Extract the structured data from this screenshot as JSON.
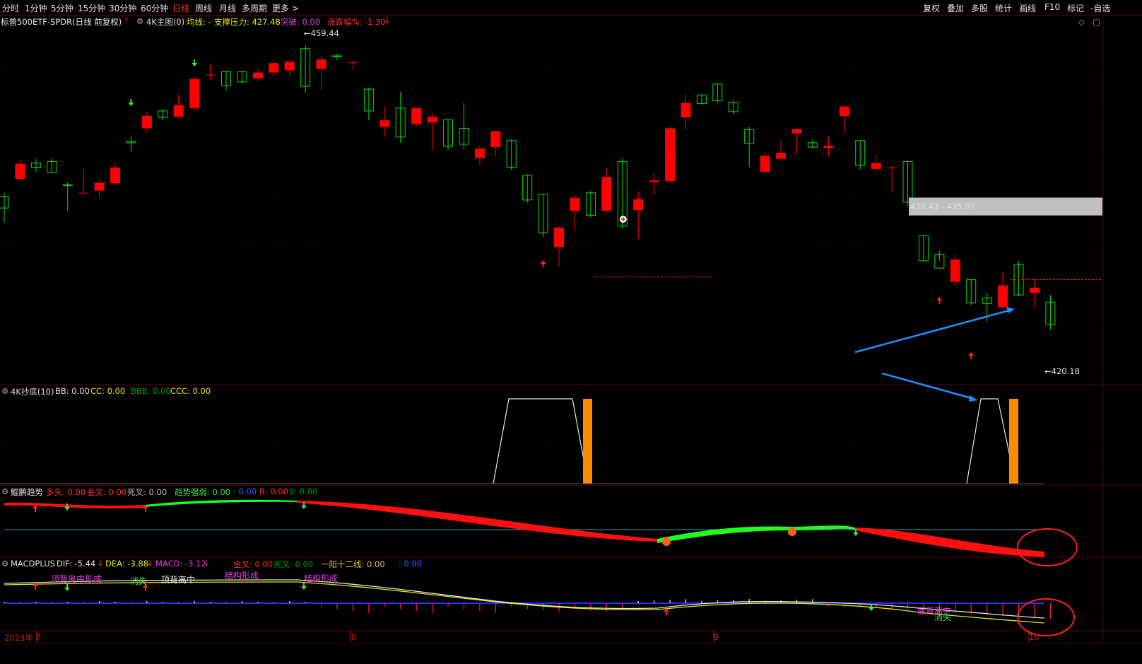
{
  "toolbar": {
    "left_tabs": [
      "分时",
      "1分钟",
      "5分钟",
      "15分钟",
      "30分钟",
      "60分钟",
      "日线",
      "周线",
      "月线",
      "多周期",
      "更多 >"
    ],
    "active": "日线",
    "right_buttons": [
      "复权",
      "叠加",
      "多股",
      "统计",
      "画线",
      "F10",
      "标记",
      "-自选"
    ]
  },
  "main_header": {
    "symbol": "标普500ETF-SPDR(日线 前复权)",
    "indicator": "4K主图(0)",
    "ma_label": "均线: -",
    "support_label": "支撑压力: 427.48",
    "break_label": "突破: 0.00",
    "change_label": "涨跌幅%: -1.30"
  },
  "price_annotations": {
    "high": "459.44",
    "low": "420.18",
    "zone": "438.43 - 435.97"
  },
  "panel_chaodi": {
    "title": "4K抄底(10)",
    "bb": "BB: 0.00",
    "cc": "CC: 0.00",
    "bbb": "BBB: 0.00",
    "ccc": "CCC: 0.00"
  },
  "panel_trend": {
    "title": "鲲鹏趋势",
    "duotou": "多头: 0.00",
    "jincha": "金叉: 0.00",
    "sicha": "死叉: 0.00",
    "strength": "趋势强弱: 0.00",
    "blank": ": 0.00",
    "b": "B: 0.00",
    "s": "S: 0.00"
  },
  "panel_macd": {
    "title": "MACDPLUS",
    "dif": "DIF: -5.44",
    "dea": "DEA: -3.88",
    "macd": "MACD: -3.12",
    "jincha": "金叉: 0.00",
    "sicha": "死叉: 0.00",
    "yiyang": "一阳十二线: 0.00",
    "blank": ": 0.00",
    "labels": [
      "顶背离中形成",
      "消失",
      "顶背离中",
      "结构形成",
      "结构形成",
      "底背离中",
      "消失"
    ]
  },
  "x_axis": {
    "year": "2023年",
    "months": [
      "7",
      "8",
      "9",
      "10"
    ]
  },
  "colors": {
    "up": "#ff0000",
    "down": "#00e000",
    "background": "#000000",
    "accent_red": "#ff3030",
    "zone_gray": "#c0c0c0",
    "blue_arrow": "#1e90ff",
    "orange_bar": "#ff8c00"
  },
  "chart_data": {
    "type": "candlestick",
    "title": "标普500ETF-SPDR",
    "candles": [
      {
        "o": 438.6,
        "h": 439.1,
        "l": 435.0,
        "c": 437.0
      },
      {
        "o": 441.0,
        "h": 443.6,
        "l": 441.0,
        "c": 443.1
      },
      {
        "o": 443.2,
        "h": 443.8,
        "l": 442.0,
        "c": 442.6
      },
      {
        "o": 443.4,
        "h": 443.9,
        "l": 441.8,
        "c": 441.9
      },
      {
        "o": 440.2,
        "h": 440.6,
        "l": 436.6,
        "c": 440.1
      },
      {
        "o": 439.1,
        "h": 442.4,
        "l": 439.0,
        "c": 439.1
      },
      {
        "o": 439.4,
        "h": 441.0,
        "l": 438.4,
        "c": 440.5
      },
      {
        "o": 440.4,
        "h": 443.3,
        "l": 440.2,
        "c": 442.6
      },
      {
        "o": 446.2,
        "h": 447.0,
        "l": 444.8,
        "c": 446.0
      },
      {
        "o": 448.0,
        "h": 450.2,
        "l": 447.4,
        "c": 449.7
      },
      {
        "o": 450.4,
        "h": 450.6,
        "l": 449.1,
        "c": 449.5
      },
      {
        "o": 449.6,
        "h": 452.7,
        "l": 449.5,
        "c": 451.2
      },
      {
        "o": 450.8,
        "h": 455.1,
        "l": 450.6,
        "c": 454.8
      },
      {
        "o": 455.3,
        "h": 457.0,
        "l": 454.6,
        "c": 455.4
      },
      {
        "o": 455.8,
        "h": 455.8,
        "l": 453.2,
        "c": 453.9
      },
      {
        "o": 455.8,
        "h": 455.9,
        "l": 454.2,
        "c": 454.4
      },
      {
        "o": 454.9,
        "h": 456.2,
        "l": 454.5,
        "c": 455.7
      },
      {
        "o": 455.7,
        "h": 457.3,
        "l": 455.1,
        "c": 457.0
      },
      {
        "o": 456.0,
        "h": 457.2,
        "l": 455.3,
        "c": 457.2
      },
      {
        "o": 459.0,
        "h": 459.44,
        "l": 452.9,
        "c": 453.8
      },
      {
        "o": 456.2,
        "h": 458.0,
        "l": 453.2,
        "c": 457.5
      },
      {
        "o": 458.0,
        "h": 458.3,
        "l": 457.4,
        "c": 457.9
      },
      {
        "o": 457.1,
        "h": 457.4,
        "l": 456.0,
        "c": 457.1
      },
      {
        "o": 453.4,
        "h": 453.6,
        "l": 449.1,
        "c": 450.4
      },
      {
        "o": 448.2,
        "h": 451.0,
        "l": 446.8,
        "c": 449.1
      },
      {
        "o": 450.8,
        "h": 453.0,
        "l": 446.0,
        "c": 446.8
      },
      {
        "o": 448.6,
        "h": 450.8,
        "l": 448.3,
        "c": 450.8
      },
      {
        "o": 448.8,
        "h": 450.1,
        "l": 444.9,
        "c": 449.6
      },
      {
        "o": 449.2,
        "h": 449.2,
        "l": 445.0,
        "c": 445.5
      },
      {
        "o": 448.0,
        "h": 451.5,
        "l": 445.1,
        "c": 445.8
      },
      {
        "o": 443.9,
        "h": 445.6,
        "l": 442.8,
        "c": 445.2
      },
      {
        "o": 445.4,
        "h": 447.7,
        "l": 444.1,
        "c": 447.6
      },
      {
        "o": 446.3,
        "h": 446.5,
        "l": 442.2,
        "c": 442.6
      },
      {
        "o": 441.5,
        "h": 441.6,
        "l": 437.7,
        "c": 438.1
      },
      {
        "o": 438.9,
        "h": 439.0,
        "l": 433.0,
        "c": 433.6
      },
      {
        "o": 431.6,
        "h": 434.5,
        "l": 428.9,
        "c": 434.3
      },
      {
        "o": 436.6,
        "h": 438.8,
        "l": 433.8,
        "c": 438.4
      },
      {
        "o": 439.1,
        "h": 439.4,
        "l": 435.7,
        "c": 436.0
      },
      {
        "o": 436.6,
        "h": 442.5,
        "l": 436.6,
        "c": 441.3
      },
      {
        "o": 443.4,
        "h": 443.9,
        "l": 434.1,
        "c": 434.5
      },
      {
        "o": 436.7,
        "h": 439.3,
        "l": 432.7,
        "c": 438.2
      },
      {
        "o": 440.6,
        "h": 441.8,
        "l": 438.8,
        "c": 440.8
      },
      {
        "o": 440.7,
        "h": 448.2,
        "l": 440.5,
        "c": 448.0
      },
      {
        "o": 449.5,
        "h": 452.7,
        "l": 447.8,
        "c": 451.5
      },
      {
        "o": 452.6,
        "h": 452.7,
        "l": 451.3,
        "c": 451.4
      },
      {
        "o": 454.1,
        "h": 454.2,
        "l": 451.5,
        "c": 451.8
      },
      {
        "o": 451.6,
        "h": 451.9,
        "l": 449.9,
        "c": 450.3
      },
      {
        "o": 447.8,
        "h": 448.2,
        "l": 442.7,
        "c": 445.9
      },
      {
        "o": 442.0,
        "h": 444.7,
        "l": 442.0,
        "c": 444.2
      },
      {
        "o": 443.8,
        "h": 446.4,
        "l": 443.8,
        "c": 444.6
      },
      {
        "o": 447.3,
        "h": 448.0,
        "l": 444.4,
        "c": 447.9
      },
      {
        "o": 446.0,
        "h": 446.5,
        "l": 445.3,
        "c": 445.4
      },
      {
        "o": 445.3,
        "h": 446.9,
        "l": 444.2,
        "c": 445.6
      },
      {
        "o": 449.7,
        "h": 451.2,
        "l": 447.3,
        "c": 451.0
      },
      {
        "o": 446.3,
        "h": 446.4,
        "l": 442.3,
        "c": 442.9
      },
      {
        "o": 442.4,
        "h": 444.3,
        "l": 442.1,
        "c": 443.2
      },
      {
        "o": 442.6,
        "h": 442.8,
        "l": 439.1,
        "c": 442.6
      },
      {
        "o": 443.4,
        "h": 443.5,
        "l": 437.3,
        "c": 437.8
      },
      {
        "o": 433.2,
        "h": 433.3,
        "l": 429.7,
        "c": 429.7
      },
      {
        "o": 430.6,
        "h": 431.1,
        "l": 429.7,
        "c": 428.7
      },
      {
        "o": 426.8,
        "h": 430.6,
        "l": 426.2,
        "c": 429.9
      },
      {
        "o": 427.1,
        "h": 427.2,
        "l": 423.5,
        "c": 423.9
      },
      {
        "o": 424.6,
        "h": 425.3,
        "l": 421.3,
        "c": 423.8
      },
      {
        "o": 423.3,
        "h": 428.1,
        "l": 422.9,
        "c": 426.3
      },
      {
        "o": 429.2,
        "h": 429.6,
        "l": 424.8,
        "c": 425.0
      },
      {
        "o": 425.3,
        "h": 427.1,
        "l": 423.2,
        "c": 426.0
      },
      {
        "o": 424.0,
        "h": 425.0,
        "l": 420.18,
        "c": 420.9
      }
    ],
    "ylim": [
      413,
      462
    ],
    "support_resistance": 427.48,
    "zone": [
      435.97,
      438.43
    ]
  }
}
